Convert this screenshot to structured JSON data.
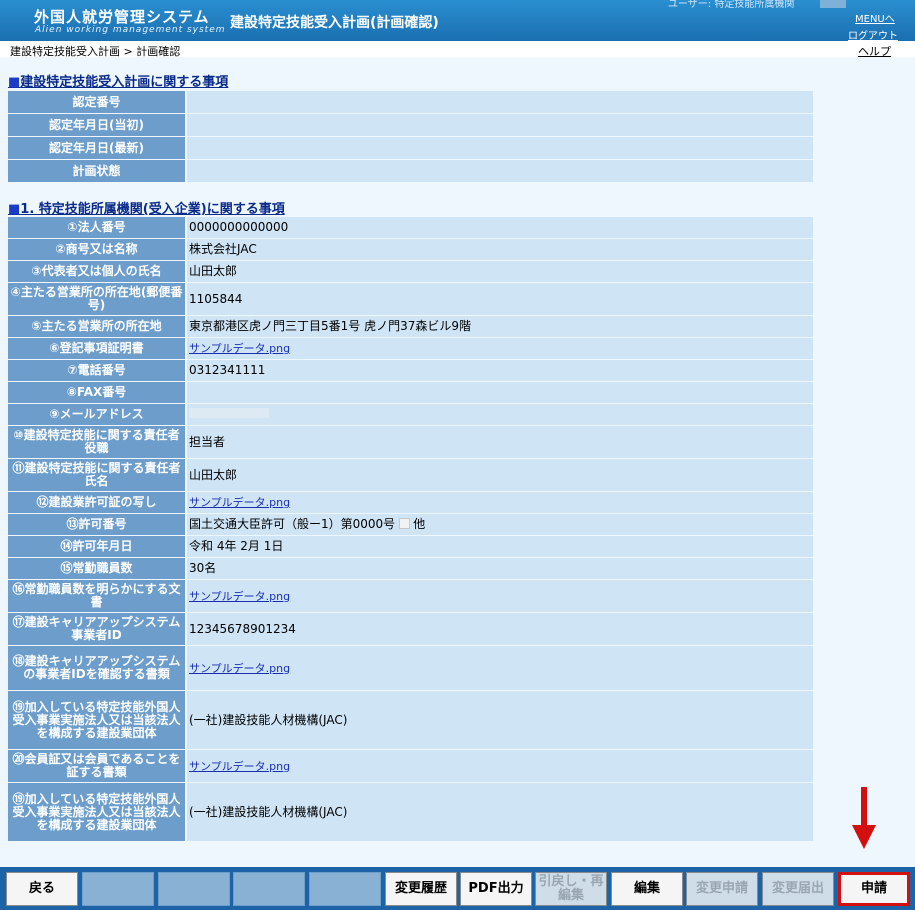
{
  "header": {
    "logo_title": "外国人就労管理システム",
    "logo_subtitle": "Alien working management system",
    "screen_title": "建設特定技能受入計画(計画確認)",
    "user_label": "ユーザー: 特定技能所属機関",
    "menu_link": "MENUへ",
    "logout_link": "ログアウト",
    "help_link": "ヘルプ"
  },
  "breadcrumb": "建設特定技能受入計画 > 計画確認",
  "section_plan": {
    "title": "建設特定技能受入計画に関する事項",
    "rows": [
      {
        "label": "認定番号",
        "value": ""
      },
      {
        "label": "認定年月日(当初)",
        "value": ""
      },
      {
        "label": "認定年月日(最新)",
        "value": ""
      },
      {
        "label": "計画状態",
        "value": ""
      }
    ]
  },
  "section_company": {
    "title": "1. 特定技能所属機関(受入企業)に関する事項",
    "rows": [
      {
        "label": "①法人番号",
        "value": "0000000000000"
      },
      {
        "label": "②商号又は名称",
        "value": "株式会社JAC"
      },
      {
        "label": "③代表者又は個人の氏名",
        "value": "山田太郎"
      },
      {
        "label": "④主たる営業所の所在地(郵便番号)",
        "value": "1105844"
      },
      {
        "label": "⑤主たる営業所の所在地",
        "value": "東京都港区虎ノ門三丁目5番1号 虎ノ門37森ビル9階"
      },
      {
        "label": "⑥登記事項証明書",
        "value": "サンプルデータ.png"
      },
      {
        "label": "⑦電話番号",
        "value": "0312341111"
      },
      {
        "label": "⑧FAX番号",
        "value": ""
      },
      {
        "label": "⑨メールアドレス",
        "value": ""
      },
      {
        "label": "⑩建設特定技能に関する責任者役職",
        "value": "担当者"
      },
      {
        "label": "⑪建設特定技能に関する責任者氏名",
        "value": "山田太郎"
      },
      {
        "label": "⑫建設業許可証の写し",
        "value": "サンプルデータ.png"
      },
      {
        "label": "⑬許可番号",
        "value": "国土交通大臣許可（般ー1）第0000号",
        "suffix": "他"
      },
      {
        "label": "⑭許可年月日",
        "value": "令和 4年 2月 1日"
      },
      {
        "label": "⑮常勤職員数",
        "value": "30名"
      },
      {
        "label": "⑯常勤職員数を明らかにする文書",
        "value": "サンプルデータ.png"
      },
      {
        "label": "⑰建設キャリアアップシステム事業者ID",
        "value": "12345678901234"
      },
      {
        "label": "⑱建設キャリアアップシステムの事業者IDを確認する書類",
        "value": "サンプルデータ.png"
      },
      {
        "label": "⑲加入している特定技能外国人受入事業実施法人又は当該法人を構成する建設業団体",
        "value": "(一社)建設技能人材機構(JAC)"
      },
      {
        "label": "⑳会員証又は会員であることを証する書類",
        "value": "サンプルデータ.png"
      },
      {
        "label": "⑲加入している特定技能外国人受入事業実施法人又は当該法人を構成する建設業団体",
        "value": "(一社)建設技能人材機構(JAC)"
      }
    ]
  },
  "buttons": {
    "back": "戻る",
    "history": "変更履歴",
    "pdf": "PDF出力",
    "withdraw": "引戻し・再編集",
    "edit": "編集",
    "change_apply": "変更申請",
    "change_notify": "変更届出",
    "apply": "申請"
  },
  "colors": {
    "header_bg": "#1a78bd",
    "label_bg": "#6c9dcb",
    "value_bg": "#cfe5f6",
    "bottom_bar": "#1d63a8",
    "highlight": "#d30f0f"
  }
}
